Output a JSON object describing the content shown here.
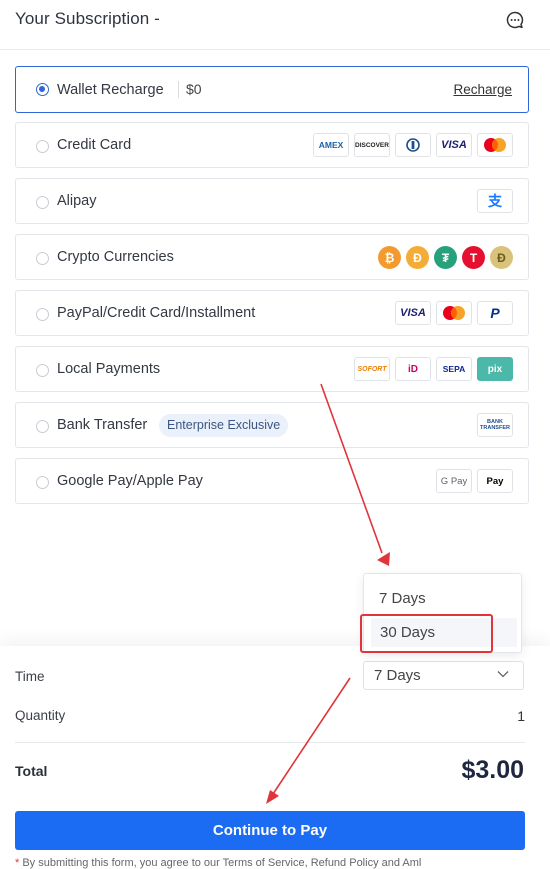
{
  "header": {
    "title": "Your Subscription -",
    "chat_icon": "chat-bubble-icon"
  },
  "payment_methods": [
    {
      "label": "Wallet Recharge",
      "balance": "$0",
      "action": "Recharge",
      "selected": true
    },
    {
      "label": "Credit Card",
      "logos": [
        "AMEX",
        "DISCOVER",
        "Diners",
        "VISA",
        "Mastercard"
      ]
    },
    {
      "label": "Alipay",
      "logos": [
        "支"
      ]
    },
    {
      "label": "Crypto Currencies",
      "logos": [
        "₿",
        "Ð",
        "₮",
        "T",
        "Ð"
      ]
    },
    {
      "label": "PayPal/Credit Card/Installment",
      "logos": [
        "VISA",
        "Mastercard",
        "P"
      ]
    },
    {
      "label": "Local Payments",
      "logos": [
        "SOFORT",
        "iD",
        "SEPA",
        "pix"
      ]
    },
    {
      "label": "Bank Transfer",
      "badge": "Enterprise Exclusive",
      "logos": [
        "BANK TRANSFER"
      ]
    },
    {
      "label": "Google Pay/Apple Pay",
      "logos": [
        "G Pay",
        " Pay"
      ]
    }
  ],
  "dropdown": {
    "options": [
      "7 Days",
      "30 Days"
    ]
  },
  "summary": {
    "time_label": "Time",
    "time_value": "7 Days",
    "quantity_label": "Quantity",
    "quantity_value": "1",
    "total_label": "Total",
    "total_value": "$3.00"
  },
  "pay_button": "Continue to Pay",
  "terms": {
    "star": "*",
    "text": "By submitting this form, you agree to our Terms of Service,  Refund Policy  and Aml"
  },
  "colors": {
    "accent": "#1b6cf2",
    "highlight": "#e0353a"
  }
}
